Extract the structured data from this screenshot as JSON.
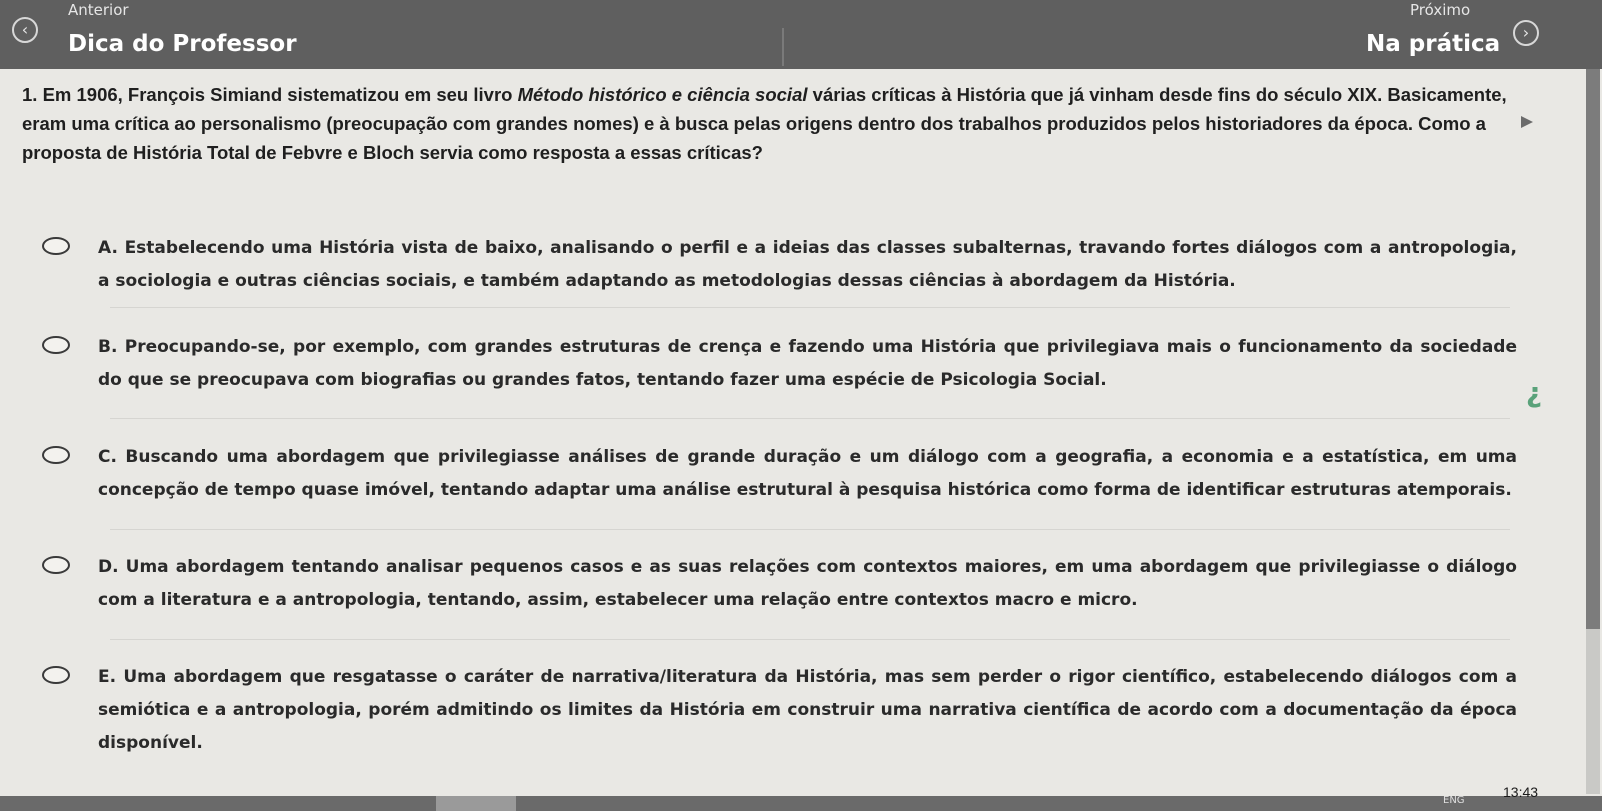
{
  "nav": {
    "prev_small": "Anterior",
    "prev_big": "Dica do Professor",
    "next_small": "Próximo",
    "next_big": "Na prática",
    "prev_icon": "chevron-left-icon",
    "next_icon": "chevron-right-icon"
  },
  "question": {
    "part1": "1. Em 1906, François Simiand sistematizou em seu livro ",
    "title": "Método histórico e ciência social",
    "part2": " várias críticas à História que já vinham desde fins do século XIX. Basicamente, eram uma crítica ao personalismo (preocupação com grandes nomes) e à busca pelas origens dentro dos trabalhos produzidos pelos historiadores da época. Como a proposta de História Total de Febvre e Bloch servia como resposta a essas críticas?"
  },
  "options": [
    {
      "text": "A. Estabelecendo uma História vista de baixo, analisando o perfil e a ideias das classes subalternas, travando fortes diálogos com a antropologia, a sociologia e outras ciências sociais, e também adaptando as metodologias dessas ciências à abordagem da História."
    },
    {
      "text": "B. Preocupando-se, por exemplo, com grandes estruturas de crença e fazendo uma História que privilegiava mais o funcionamento da sociedade do que se preocupava com biografias ou grandes fatos, tentando fazer uma espécie de Psicologia Social."
    },
    {
      "text": "C. Buscando uma abordagem que privilegiasse análises de grande duração e um diálogo com a geografia, a economia e a estatística, em uma concepção de tempo quase imóvel, tentando adaptar uma análise estrutural à pesquisa histórica como forma de identificar estruturas atemporais."
    },
    {
      "text": "D. Uma abordagem tentando analisar pequenos casos e as suas relações com contextos maiores, em uma abordagem que privilegiasse o diálogo com a literatura e a antropologia, tentando, assim, estabelecer uma relação entre contextos macro e micro."
    },
    {
      "text": "E. Uma abordagem que resgatasse o caráter de narrativa/literatura da História, mas sem perder o rigor científico, estabelecendo diálogos com a semiótica e a antropologia, porém admitindo os limites da História em construir uma narrativa científica de acordo com a documentação da época disponível."
    }
  ],
  "taskbar": {
    "clock": "13:43",
    "lang": "ENG"
  }
}
